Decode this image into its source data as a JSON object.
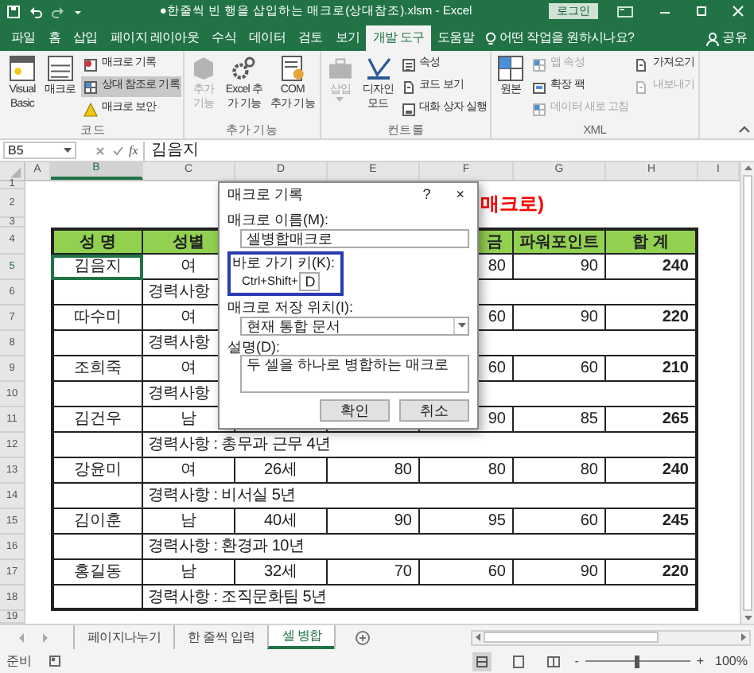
{
  "window": {
    "title": "●한줄씩 빈 행을 삽입하는 매크로(상대참조).xlsm - Excel",
    "login": "로그인"
  },
  "menu_tabs": [
    {
      "label": "파일",
      "selected": false
    },
    {
      "label": "홈",
      "selected": false
    },
    {
      "label": "삽입",
      "selected": false
    },
    {
      "label": "페이지 레이아웃",
      "selected": false
    },
    {
      "label": "수식",
      "selected": false
    },
    {
      "label": "데이터",
      "selected": false
    },
    {
      "label": "검토",
      "selected": false
    },
    {
      "label": "보기",
      "selected": false
    },
    {
      "label": "개발 도구",
      "selected": true
    },
    {
      "label": "도움말",
      "selected": false
    }
  ],
  "tell_me": "어떤 작업을 원하시나요?",
  "share": "공유",
  "ribbon_groups": [
    {
      "label": "코드",
      "items": [
        {
          "kind": "large",
          "label": "Visual\nBasic",
          "disabled": false,
          "on": false
        },
        {
          "kind": "large",
          "label": "매크로",
          "disabled": false,
          "on": false
        },
        {
          "kind": "small",
          "label": "매크로 기록",
          "disabled": false,
          "on": false
        },
        {
          "kind": "small",
          "label": "상대 참조로 기록",
          "disabled": false,
          "on": true
        },
        {
          "kind": "small",
          "label": "매크로 보안",
          "disabled": false,
          "on": false
        }
      ]
    },
    {
      "label": "추가 기능",
      "items": [
        {
          "kind": "large",
          "label": "추가\n기능",
          "disabled": true,
          "on": false
        },
        {
          "kind": "large",
          "label": "Excel 추\n가 기능",
          "disabled": false,
          "on": false
        },
        {
          "kind": "large",
          "label": "COM\n추가 기능",
          "disabled": false,
          "on": false
        }
      ]
    },
    {
      "label": "컨트롤",
      "items": [
        {
          "kind": "large",
          "label": "삽입",
          "disabled": true,
          "on": false
        },
        {
          "kind": "large",
          "label": "디자인\n모드",
          "disabled": false,
          "on": false
        },
        {
          "kind": "small",
          "label": "속성",
          "disabled": false,
          "on": false
        },
        {
          "kind": "small",
          "label": "코드 보기",
          "disabled": false,
          "on": false
        },
        {
          "kind": "small",
          "label": "대화 상자 실행",
          "disabled": false,
          "on": false
        }
      ]
    },
    {
      "label": "XML",
      "items": [
        {
          "kind": "large",
          "label": "원본",
          "disabled": false,
          "on": false
        },
        {
          "kind": "small",
          "label": "맵 속성",
          "disabled": true,
          "on": false
        },
        {
          "kind": "small",
          "label": "확장 팩",
          "disabled": false,
          "on": false
        },
        {
          "kind": "small",
          "label": "데이터 새로 고침",
          "disabled": true,
          "on": false
        },
        {
          "kind": "small",
          "label": "가져오기",
          "disabled": false,
          "on": false
        },
        {
          "kind": "small",
          "label": "내보내기",
          "disabled": true,
          "on": false
        }
      ]
    }
  ],
  "formula_bar": {
    "name_box": "B5",
    "fx": "fx",
    "value": "김음지"
  },
  "columns": [
    "A",
    "B",
    "C",
    "D",
    "E",
    "F",
    "G",
    "H",
    "I"
  ],
  "row_numbers": [
    "1",
    "2",
    "3",
    "4",
    "5",
    "6",
    "7",
    "8",
    "9",
    "10",
    "11",
    "12",
    "13",
    "14",
    "15",
    "16",
    "17",
    "18",
    "19"
  ],
  "sheet_title": "매크로)",
  "header": {
    "B": "성 명",
    "C": "성별",
    "F": "금",
    "G": "파워포인트",
    "H": "합 계"
  },
  "rows": [
    {
      "kind": "record",
      "selected": true,
      "B": "김음지",
      "C": "여",
      "F": "80",
      "G": "90",
      "H": "240"
    },
    {
      "kind": "career",
      "selected": false,
      "text": "경력사항"
    },
    {
      "kind": "record",
      "selected": false,
      "B": "따수미",
      "C": "여",
      "F": "60",
      "G": "90",
      "H": "220"
    },
    {
      "kind": "career",
      "selected": false,
      "text": "경력사항"
    },
    {
      "kind": "record",
      "selected": false,
      "B": "조희죽",
      "C": "여",
      "F": "60",
      "G": "60",
      "H": "210"
    },
    {
      "kind": "career",
      "selected": false,
      "text": "경력사항"
    },
    {
      "kind": "record",
      "selected": false,
      "B": "김건우",
      "C": "남",
      "F": "90",
      "G": "85",
      "H": "265"
    },
    {
      "kind": "career",
      "selected": false,
      "text": "경력사항 : 총무과 근무 4년"
    },
    {
      "kind": "record",
      "selected": false,
      "B": "강윤미",
      "C": "여",
      "D": "26세",
      "E": "80",
      "F": "80",
      "G": "80",
      "H": "240"
    },
    {
      "kind": "career",
      "selected": false,
      "text": "경력사항 : 비서실 5년"
    },
    {
      "kind": "record",
      "selected": false,
      "B": "김이훈",
      "C": "남",
      "D": "40세",
      "E": "90",
      "F": "95",
      "G": "60",
      "H": "245"
    },
    {
      "kind": "career",
      "selected": false,
      "text": "경력사항 : 환경과 10년"
    },
    {
      "kind": "record",
      "selected": false,
      "B": "홍길동",
      "C": "남",
      "D": "32세",
      "E": "70",
      "F": "60",
      "G": "90",
      "H": "220"
    },
    {
      "kind": "career",
      "selected": false,
      "text": "경력사항 : 조직문화팀 5년"
    }
  ],
  "dialog": {
    "title": "매크로 기록",
    "help": "?",
    "close": "×",
    "name_label": "매크로 이름(M):",
    "name_value": "셀병합매크로",
    "shortcut_label": "바로 가기 키(K):",
    "shortcut_prefix": "Ctrl+Shift+",
    "shortcut_value": "D",
    "store_label": "매크로 저장 위치(I):",
    "store_value": "현재 통합 문서",
    "desc_label": "설명(D):",
    "desc_value": "두 셀을 하나로 병합하는 매크로",
    "buttons": [
      "확인",
      "취소"
    ]
  },
  "sheet_tabs": [
    {
      "label": "페이지나누기",
      "selected": false
    },
    {
      "label": "한 줄씩 입력",
      "selected": false
    },
    {
      "label": "셀 병합",
      "selected": true
    }
  ],
  "status_bar": {
    "text": "준비",
    "zoom_out": "-",
    "zoom_in": "+",
    "zoom": "100%",
    "zoom_slider": {
      "level": 0.5
    }
  }
}
